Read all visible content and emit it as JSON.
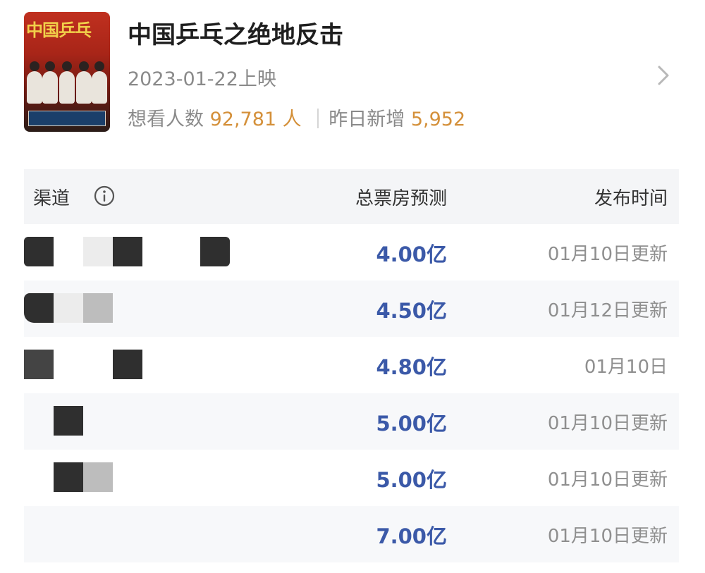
{
  "movie": {
    "poster_title": "中国乒乓",
    "title": "中国乒乓之绝地反击",
    "release": "2023-01-22上映",
    "want_label": "想看人数",
    "want_count": "92,781 人",
    "new_label": "昨日新增",
    "new_count": "5,952"
  },
  "table": {
    "headers": {
      "channel": "渠道",
      "forecast": "总票房预测",
      "time": "发布时间"
    },
    "rows": [
      {
        "forecast": "4.00亿",
        "time": "01月10日更新"
      },
      {
        "forecast": "4.50亿",
        "time": "01月12日更新"
      },
      {
        "forecast": "4.80亿",
        "time": "01月10日"
      },
      {
        "forecast": "5.00亿",
        "time": "01月10日更新"
      },
      {
        "forecast": "5.00亿",
        "time": "01月10日更新"
      },
      {
        "forecast": "7.00亿",
        "time": "01月10日更新"
      }
    ]
  },
  "icons": {
    "info": "info-icon",
    "chevron": "chevron-right-icon"
  },
  "colors": {
    "accent_orange": "#d4903a",
    "forecast_blue": "#3b59a8",
    "header_bg": "#f4f5f7"
  }
}
